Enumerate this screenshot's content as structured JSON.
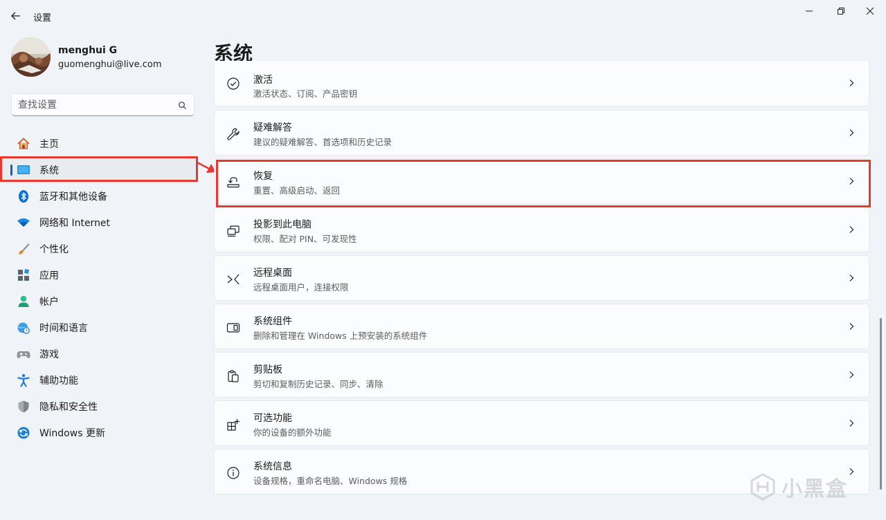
{
  "window": {
    "title": "设置"
  },
  "user": {
    "name": "menghui G",
    "email": "guomenghui@live.com"
  },
  "search": {
    "placeholder": "查找设置"
  },
  "sidebar": {
    "items": [
      {
        "label": "主页",
        "icon": "home-icon"
      },
      {
        "label": "系统",
        "icon": "system-icon",
        "selected": true
      },
      {
        "label": "蓝牙和其他设备",
        "icon": "bluetooth-icon"
      },
      {
        "label": "网络和 Internet",
        "icon": "wifi-icon"
      },
      {
        "label": "个性化",
        "icon": "brush-icon"
      },
      {
        "label": "应用",
        "icon": "apps-icon"
      },
      {
        "label": "帐户",
        "icon": "account-icon"
      },
      {
        "label": "时间和语言",
        "icon": "globe-clock-icon"
      },
      {
        "label": "游戏",
        "icon": "gamepad-icon"
      },
      {
        "label": "辅助功能",
        "icon": "accessibility-icon"
      },
      {
        "label": "隐私和安全性",
        "icon": "shield-icon"
      },
      {
        "label": "Windows 更新",
        "icon": "update-icon"
      }
    ]
  },
  "main": {
    "title": "系统",
    "cards": [
      {
        "title": "激活",
        "subtitle": "激活状态、订阅、产品密钥",
        "icon": "check-circle-icon"
      },
      {
        "title": "疑难解答",
        "subtitle": "建议的疑难解答、首选项和历史记录",
        "icon": "wrench-icon"
      },
      {
        "title": "恢复",
        "subtitle": "重置、高级启动、返回",
        "icon": "recovery-icon"
      },
      {
        "title": "投影到此电脑",
        "subtitle": "权限、配对 PIN、可发现性",
        "icon": "project-icon"
      },
      {
        "title": "远程桌面",
        "subtitle": "远程桌面用户，连接权限",
        "icon": "remote-desktop-icon"
      },
      {
        "title": "系统组件",
        "subtitle": "删除和管理在 Windows 上预安装的系统组件",
        "icon": "components-icon"
      },
      {
        "title": "剪贴板",
        "subtitle": "剪切和复制历史记录、同步、清除",
        "icon": "clipboard-icon"
      },
      {
        "title": "可选功能",
        "subtitle": "你的设备的额外功能",
        "icon": "optional-features-icon"
      },
      {
        "title": "系统信息",
        "subtitle": "设备规格，重命名电脑、Windows 规格",
        "icon": "info-icon"
      }
    ]
  },
  "watermark": {
    "text": "小黑盒"
  },
  "colors": {
    "accent": "#0067c0",
    "highlight": "#e53935"
  }
}
